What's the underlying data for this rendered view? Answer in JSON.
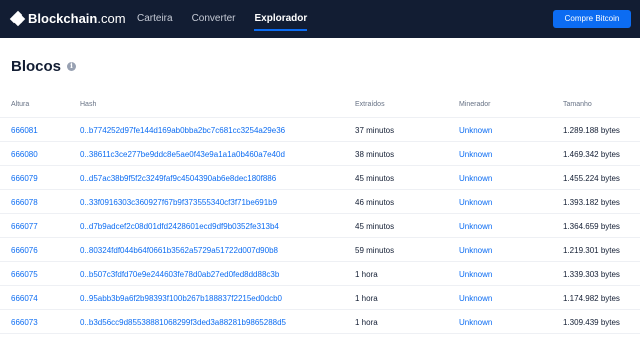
{
  "brand": {
    "name_bold": "Blockchain",
    "name_light": ".com"
  },
  "nav": {
    "items": [
      {
        "label": "Carteira"
      },
      {
        "label": "Converter"
      },
      {
        "label": "Explorador"
      }
    ],
    "active_index": 2,
    "buy_label": "Compre Bitcoin"
  },
  "page": {
    "title": "Blocos"
  },
  "table": {
    "columns": [
      "Altura",
      "Hash",
      "Extraídos",
      "Minerador",
      "Tamanho"
    ],
    "rows": [
      {
        "height": "666081",
        "hash": "0..b774252d97fe144d169ab0bba2bc7c681cc3254a29e36",
        "mined": "37 minutos",
        "miner": "Unknown",
        "size": "1.289.188 bytes"
      },
      {
        "height": "666080",
        "hash": "0..38611c3ce277be9ddc8e5ae0f43e9a1a1a0b460a7e40d",
        "mined": "38 minutos",
        "miner": "Unknown",
        "size": "1.469.342 bytes"
      },
      {
        "height": "666079",
        "hash": "0..d57ac38b9f5f2c3249faf9c4504390ab6e8dec180f886",
        "mined": "45 minutos",
        "miner": "Unknown",
        "size": "1.455.224 bytes"
      },
      {
        "height": "666078",
        "hash": "0..33f0916303c360927f67b9f373555340cf3f71be691b9",
        "mined": "46 minutos",
        "miner": "Unknown",
        "size": "1.393.182 bytes"
      },
      {
        "height": "666077",
        "hash": "0..d7b9adcef2c08d01dfd2428601ecd9df9b0352fe313b4",
        "mined": "45 minutos",
        "miner": "Unknown",
        "size": "1.364.659 bytes"
      },
      {
        "height": "666076",
        "hash": "0..80324fdf044b64f0661b3562a5729a51722d007d90b8",
        "mined": "59 minutos",
        "miner": "Unknown",
        "size": "1.219.301 bytes"
      },
      {
        "height": "666075",
        "hash": "0..b507c3fdfd70e9e244603fe78d0ab27ed0fed8dd88c3b",
        "mined": "1 hora",
        "miner": "Unknown",
        "size": "1.339.303 bytes"
      },
      {
        "height": "666074",
        "hash": "0..95abb3b9a6f2b98393f100b267b188837f2215ed0dcb0",
        "mined": "1 hora",
        "miner": "Unknown",
        "size": "1.174.982 bytes"
      },
      {
        "height": "666073",
        "hash": "0..b3d56cc9d85538881068299f3ded3a88281b9865288d5",
        "mined": "1 hora",
        "miner": "Unknown",
        "size": "1.309.439 bytes"
      }
    ]
  },
  "colors": {
    "navbar_bg": "#121d33",
    "accent": "#0c6cf2",
    "text": "#121d33",
    "muted": "#677285"
  }
}
